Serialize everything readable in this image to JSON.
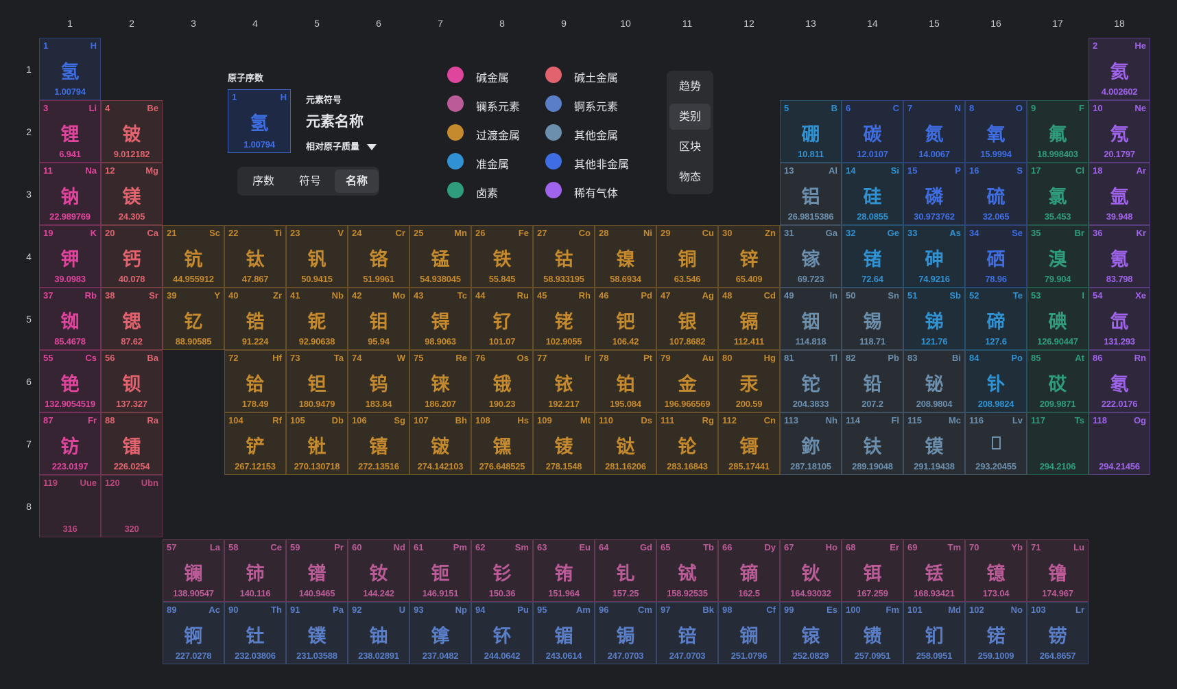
{
  "groups": [
    "1",
    "2",
    "3",
    "4",
    "5",
    "6",
    "7",
    "8",
    "9",
    "10",
    "11",
    "12",
    "13",
    "14",
    "15",
    "16",
    "17",
    "18"
  ],
  "periods": [
    "1",
    "2",
    "3",
    "4",
    "5",
    "6",
    "7",
    "8"
  ],
  "key": {
    "atomic_number_label": "原子序数",
    "symbol_label": "元素符号",
    "name_label": "元素名称",
    "mass_label": "相对原子质量",
    "sample": {
      "number": "1",
      "symbol": "H",
      "name": "氢",
      "mass": "1.00794"
    }
  },
  "display_modes": [
    {
      "label": "序数",
      "active": false
    },
    {
      "label": "符号",
      "active": false
    },
    {
      "label": "名称",
      "active": true
    }
  ],
  "view_modes": [
    {
      "label": "趋势",
      "active": false
    },
    {
      "label": "类别",
      "active": true
    },
    {
      "label": "区块",
      "active": false
    },
    {
      "label": "物态",
      "active": false
    }
  ],
  "categories": {
    "alkali": {
      "label": "碱金属",
      "color": "#e0459d"
    },
    "alkaline": {
      "label": "碱土金属",
      "color": "#e2636e"
    },
    "lanthanide": {
      "label": "镧系元素",
      "color": "#bb5c98"
    },
    "actinide": {
      "label": "锕系元素",
      "color": "#5a7fc8"
    },
    "transition": {
      "label": "过渡金属",
      "color": "#c58a2e"
    },
    "post": {
      "label": "其他金属",
      "color": "#6d8fae"
    },
    "metalloid": {
      "label": "准金属",
      "color": "#3092d2"
    },
    "nonmetal": {
      "label": "其他非金属",
      "color": "#3f6ee4"
    },
    "halogen": {
      "label": "卤素",
      "color": "#2f9c7e"
    },
    "noble": {
      "label": "稀有气体",
      "color": "#a063ec"
    },
    "unknown": {
      "label": "",
      "color": "#b8487e"
    }
  },
  "legend_order": [
    "alkali",
    "alkaline",
    "lanthanide",
    "actinide",
    "transition",
    "post",
    "metalloid",
    "nonmetal",
    "halogen",
    "noble"
  ],
  "elements": [
    {
      "n": "1",
      "s": "H",
      "name": "氢",
      "m": "1.00794",
      "row": 1,
      "col": 1,
      "cat": "nonmetal"
    },
    {
      "n": "2",
      "s": "He",
      "name": "氦",
      "m": "4.002602",
      "row": 1,
      "col": 18,
      "cat": "noble"
    },
    {
      "n": "3",
      "s": "Li",
      "name": "锂",
      "m": "6.941",
      "row": 2,
      "col": 1,
      "cat": "alkali"
    },
    {
      "n": "4",
      "s": "Be",
      "name": "铍",
      "m": "9.012182",
      "row": 2,
      "col": 2,
      "cat": "alkaline"
    },
    {
      "n": "5",
      "s": "B",
      "name": "硼",
      "m": "10.811",
      "row": 2,
      "col": 13,
      "cat": "metalloid"
    },
    {
      "n": "6",
      "s": "C",
      "name": "碳",
      "m": "12.0107",
      "row": 2,
      "col": 14,
      "cat": "nonmetal"
    },
    {
      "n": "7",
      "s": "N",
      "name": "氮",
      "m": "14.0067",
      "row": 2,
      "col": 15,
      "cat": "nonmetal"
    },
    {
      "n": "8",
      "s": "O",
      "name": "氧",
      "m": "15.9994",
      "row": 2,
      "col": 16,
      "cat": "nonmetal"
    },
    {
      "n": "9",
      "s": "F",
      "name": "氟",
      "m": "18.998403",
      "row": 2,
      "col": 17,
      "cat": "halogen"
    },
    {
      "n": "10",
      "s": "Ne",
      "name": "氖",
      "m": "20.1797",
      "row": 2,
      "col": 18,
      "cat": "noble"
    },
    {
      "n": "11",
      "s": "Na",
      "name": "钠",
      "m": "22.989769",
      "row": 3,
      "col": 1,
      "cat": "alkali"
    },
    {
      "n": "12",
      "s": "Mg",
      "name": "镁",
      "m": "24.305",
      "row": 3,
      "col": 2,
      "cat": "alkaline"
    },
    {
      "n": "13",
      "s": "Al",
      "name": "铝",
      "m": "26.9815386",
      "row": 3,
      "col": 13,
      "cat": "post"
    },
    {
      "n": "14",
      "s": "Si",
      "name": "硅",
      "m": "28.0855",
      "row": 3,
      "col": 14,
      "cat": "metalloid"
    },
    {
      "n": "15",
      "s": "P",
      "name": "磷",
      "m": "30.973762",
      "row": 3,
      "col": 15,
      "cat": "nonmetal"
    },
    {
      "n": "16",
      "s": "S",
      "name": "硫",
      "m": "32.065",
      "row": 3,
      "col": 16,
      "cat": "nonmetal"
    },
    {
      "n": "17",
      "s": "Cl",
      "name": "氯",
      "m": "35.453",
      "row": 3,
      "col": 17,
      "cat": "halogen"
    },
    {
      "n": "18",
      "s": "Ar",
      "name": "氩",
      "m": "39.948",
      "row": 3,
      "col": 18,
      "cat": "noble"
    },
    {
      "n": "19",
      "s": "K",
      "name": "钾",
      "m": "39.0983",
      "row": 4,
      "col": 1,
      "cat": "alkali"
    },
    {
      "n": "20",
      "s": "Ca",
      "name": "钙",
      "m": "40.078",
      "row": 4,
      "col": 2,
      "cat": "alkaline"
    },
    {
      "n": "21",
      "s": "Sc",
      "name": "钪",
      "m": "44.955912",
      "row": 4,
      "col": 3,
      "cat": "transition"
    },
    {
      "n": "22",
      "s": "Ti",
      "name": "钛",
      "m": "47.867",
      "row": 4,
      "col": 4,
      "cat": "transition"
    },
    {
      "n": "23",
      "s": "V",
      "name": "钒",
      "m": "50.9415",
      "row": 4,
      "col": 5,
      "cat": "transition"
    },
    {
      "n": "24",
      "s": "Cr",
      "name": "铬",
      "m": "51.9961",
      "row": 4,
      "col": 6,
      "cat": "transition"
    },
    {
      "n": "25",
      "s": "Mn",
      "name": "锰",
      "m": "54.938045",
      "row": 4,
      "col": 7,
      "cat": "transition"
    },
    {
      "n": "26",
      "s": "Fe",
      "name": "铁",
      "m": "55.845",
      "row": 4,
      "col": 8,
      "cat": "transition"
    },
    {
      "n": "27",
      "s": "Co",
      "name": "钴",
      "m": "58.933195",
      "row": 4,
      "col": 9,
      "cat": "transition"
    },
    {
      "n": "28",
      "s": "Ni",
      "name": "镍",
      "m": "58.6934",
      "row": 4,
      "col": 10,
      "cat": "transition"
    },
    {
      "n": "29",
      "s": "Cu",
      "name": "铜",
      "m": "63.546",
      "row": 4,
      "col": 11,
      "cat": "transition"
    },
    {
      "n": "30",
      "s": "Zn",
      "name": "锌",
      "m": "65.409",
      "row": 4,
      "col": 12,
      "cat": "transition"
    },
    {
      "n": "31",
      "s": "Ga",
      "name": "镓",
      "m": "69.723",
      "row": 4,
      "col": 13,
      "cat": "post"
    },
    {
      "n": "32",
      "s": "Ge",
      "name": "锗",
      "m": "72.64",
      "row": 4,
      "col": 14,
      "cat": "metalloid"
    },
    {
      "n": "33",
      "s": "As",
      "name": "砷",
      "m": "74.9216",
      "row": 4,
      "col": 15,
      "cat": "metalloid"
    },
    {
      "n": "34",
      "s": "Se",
      "name": "硒",
      "m": "78.96",
      "row": 4,
      "col": 16,
      "cat": "nonmetal"
    },
    {
      "n": "35",
      "s": "Br",
      "name": "溴",
      "m": "79.904",
      "row": 4,
      "col": 17,
      "cat": "halogen"
    },
    {
      "n": "36",
      "s": "Kr",
      "name": "氪",
      "m": "83.798",
      "row": 4,
      "col": 18,
      "cat": "noble"
    },
    {
      "n": "37",
      "s": "Rb",
      "name": "铷",
      "m": "85.4678",
      "row": 5,
      "col": 1,
      "cat": "alkali"
    },
    {
      "n": "38",
      "s": "Sr",
      "name": "锶",
      "m": "87.62",
      "row": 5,
      "col": 2,
      "cat": "alkaline"
    },
    {
      "n": "39",
      "s": "Y",
      "name": "钇",
      "m": "88.90585",
      "row": 5,
      "col": 3,
      "cat": "transition"
    },
    {
      "n": "40",
      "s": "Zr",
      "name": "锆",
      "m": "91.224",
      "row": 5,
      "col": 4,
      "cat": "transition"
    },
    {
      "n": "41",
      "s": "Nb",
      "name": "铌",
      "m": "92.90638",
      "row": 5,
      "col": 5,
      "cat": "transition"
    },
    {
      "n": "42",
      "s": "Mo",
      "name": "钼",
      "m": "95.94",
      "row": 5,
      "col": 6,
      "cat": "transition"
    },
    {
      "n": "43",
      "s": "Tc",
      "name": "锝",
      "m": "98.9063",
      "row": 5,
      "col": 7,
      "cat": "transition"
    },
    {
      "n": "44",
      "s": "Ru",
      "name": "钌",
      "m": "101.07",
      "row": 5,
      "col": 8,
      "cat": "transition"
    },
    {
      "n": "45",
      "s": "Rh",
      "name": "铑",
      "m": "102.9055",
      "row": 5,
      "col": 9,
      "cat": "transition"
    },
    {
      "n": "46",
      "s": "Pd",
      "name": "钯",
      "m": "106.42",
      "row": 5,
      "col": 10,
      "cat": "transition"
    },
    {
      "n": "47",
      "s": "Ag",
      "name": "银",
      "m": "107.8682",
      "row": 5,
      "col": 11,
      "cat": "transition"
    },
    {
      "n": "48",
      "s": "Cd",
      "name": "镉",
      "m": "112.411",
      "row": 5,
      "col": 12,
      "cat": "transition"
    },
    {
      "n": "49",
      "s": "In",
      "name": "铟",
      "m": "114.818",
      "row": 5,
      "col": 13,
      "cat": "post"
    },
    {
      "n": "50",
      "s": "Sn",
      "name": "锡",
      "m": "118.71",
      "row": 5,
      "col": 14,
      "cat": "post"
    },
    {
      "n": "51",
      "s": "Sb",
      "name": "锑",
      "m": "121.76",
      "row": 5,
      "col": 15,
      "cat": "metalloid"
    },
    {
      "n": "52",
      "s": "Te",
      "name": "碲",
      "m": "127.6",
      "row": 5,
      "col": 16,
      "cat": "metalloid"
    },
    {
      "n": "53",
      "s": "I",
      "name": "碘",
      "m": "126.90447",
      "row": 5,
      "col": 17,
      "cat": "halogen"
    },
    {
      "n": "54",
      "s": "Xe",
      "name": "氙",
      "m": "131.293",
      "row": 5,
      "col": 18,
      "cat": "noble"
    },
    {
      "n": "55",
      "s": "Cs",
      "name": "铯",
      "m": "132.9054519",
      "row": 6,
      "col": 1,
      "cat": "alkali"
    },
    {
      "n": "56",
      "s": "Ba",
      "name": "钡",
      "m": "137.327",
      "row": 6,
      "col": 2,
      "cat": "alkaline"
    },
    {
      "n": "72",
      "s": "Hf",
      "name": "铪",
      "m": "178.49",
      "row": 6,
      "col": 4,
      "cat": "transition"
    },
    {
      "n": "73",
      "s": "Ta",
      "name": "钽",
      "m": "180.9479",
      "row": 6,
      "col": 5,
      "cat": "transition"
    },
    {
      "n": "74",
      "s": "W",
      "name": "钨",
      "m": "183.84",
      "row": 6,
      "col": 6,
      "cat": "transition"
    },
    {
      "n": "75",
      "s": "Re",
      "name": "铼",
      "m": "186.207",
      "row": 6,
      "col": 7,
      "cat": "transition"
    },
    {
      "n": "76",
      "s": "Os",
      "name": "锇",
      "m": "190.23",
      "row": 6,
      "col": 8,
      "cat": "transition"
    },
    {
      "n": "77",
      "s": "Ir",
      "name": "铱",
      "m": "192.217",
      "row": 6,
      "col": 9,
      "cat": "transition"
    },
    {
      "n": "78",
      "s": "Pt",
      "name": "铂",
      "m": "195.084",
      "row": 6,
      "col": 10,
      "cat": "transition"
    },
    {
      "n": "79",
      "s": "Au",
      "name": "金",
      "m": "196.966569",
      "row": 6,
      "col": 11,
      "cat": "transition"
    },
    {
      "n": "80",
      "s": "Hg",
      "name": "汞",
      "m": "200.59",
      "row": 6,
      "col": 12,
      "cat": "transition"
    },
    {
      "n": "81",
      "s": "Tl",
      "name": "铊",
      "m": "204.3833",
      "row": 6,
      "col": 13,
      "cat": "post"
    },
    {
      "n": "82",
      "s": "Pb",
      "name": "铅",
      "m": "207.2",
      "row": 6,
      "col": 14,
      "cat": "post"
    },
    {
      "n": "83",
      "s": "Bi",
      "name": "铋",
      "m": "208.9804",
      "row": 6,
      "col": 15,
      "cat": "post"
    },
    {
      "n": "84",
      "s": "Po",
      "name": "钋",
      "m": "208.9824",
      "row": 6,
      "col": 16,
      "cat": "metalloid"
    },
    {
      "n": "85",
      "s": "At",
      "name": "砹",
      "m": "209.9871",
      "row": 6,
      "col": 17,
      "cat": "halogen"
    },
    {
      "n": "86",
      "s": "Rn",
      "name": "氡",
      "m": "222.0176",
      "row": 6,
      "col": 18,
      "cat": "noble"
    },
    {
      "n": "87",
      "s": "Fr",
      "name": "钫",
      "m": "223.0197",
      "row": 7,
      "col": 1,
      "cat": "alkali"
    },
    {
      "n": "88",
      "s": "Ra",
      "name": "镭",
      "m": "226.0254",
      "row": 7,
      "col": 2,
      "cat": "alkaline"
    },
    {
      "n": "104",
      "s": "Rf",
      "name": "铲",
      "m": "267.12153",
      "row": 7,
      "col": 4,
      "cat": "transition"
    },
    {
      "n": "105",
      "s": "Db",
      "name": "𬭊",
      "m": "270.130718",
      "row": 7,
      "col": 5,
      "cat": "transition"
    },
    {
      "n": "106",
      "s": "Sg",
      "name": "𬭳",
      "m": "272.13516",
      "row": 7,
      "col": 6,
      "cat": "transition"
    },
    {
      "n": "107",
      "s": "Bh",
      "name": "𬭛",
      "m": "274.142103",
      "row": 7,
      "col": 7,
      "cat": "transition"
    },
    {
      "n": "108",
      "s": "Hs",
      "name": "𬭶",
      "m": "276.648525",
      "row": 7,
      "col": 8,
      "cat": "transition"
    },
    {
      "n": "109",
      "s": "Mt",
      "name": "鿏",
      "m": "278.1548",
      "row": 7,
      "col": 9,
      "cat": "transition"
    },
    {
      "n": "110",
      "s": "Ds",
      "name": "𫟼",
      "m": "281.16206",
      "row": 7,
      "col": 10,
      "cat": "transition"
    },
    {
      "n": "111",
      "s": "Rg",
      "name": "𬬭",
      "m": "283.16843",
      "row": 7,
      "col": 11,
      "cat": "transition"
    },
    {
      "n": "112",
      "s": "Cn",
      "name": "鿔",
      "m": "285.17441",
      "row": 7,
      "col": 12,
      "cat": "transition"
    },
    {
      "n": "113",
      "s": "Nh",
      "name": "鉨",
      "m": "287.18105",
      "row": 7,
      "col": 13,
      "cat": "post"
    },
    {
      "n": "114",
      "s": "Fl",
      "name": "𫓧",
      "m": "289.19048",
      "row": 7,
      "col": 14,
      "cat": "post"
    },
    {
      "n": "115",
      "s": "Mc",
      "name": "镆",
      "m": "291.19438",
      "row": 7,
      "col": 15,
      "cat": "post"
    },
    {
      "n": "116",
      "s": "Lv",
      "name": "𫟷",
      "m": "293.20455",
      "row": 7,
      "col": 16,
      "cat": "post"
    },
    {
      "n": "117",
      "s": "Ts",
      "name": "",
      "m": "294.2106",
      "row": 7,
      "col": 17,
      "cat": "halogen"
    },
    {
      "n": "118",
      "s": "Og",
      "name": "",
      "m": "294.21456",
      "row": 7,
      "col": 18,
      "cat": "noble"
    },
    {
      "n": "119",
      "s": "Uue",
      "name": "",
      "m": "316",
      "row": 8,
      "col": 1,
      "cat": "unknown"
    },
    {
      "n": "120",
      "s": "Ubn",
      "name": "",
      "m": "320",
      "row": 8,
      "col": 2,
      "cat": "unknown"
    },
    {
      "n": "57",
      "s": "La",
      "name": "镧",
      "m": "138.90547",
      "row": 9,
      "col": 3,
      "cat": "lanthanide"
    },
    {
      "n": "58",
      "s": "Ce",
      "name": "铈",
      "m": "140.116",
      "row": 9,
      "col": 4,
      "cat": "lanthanide"
    },
    {
      "n": "59",
      "s": "Pr",
      "name": "镨",
      "m": "140.9465",
      "row": 9,
      "col": 5,
      "cat": "lanthanide"
    },
    {
      "n": "60",
      "s": "Nd",
      "name": "钕",
      "m": "144.242",
      "row": 9,
      "col": 6,
      "cat": "lanthanide"
    },
    {
      "n": "61",
      "s": "Pm",
      "name": "钷",
      "m": "146.9151",
      "row": 9,
      "col": 7,
      "cat": "lanthanide"
    },
    {
      "n": "62",
      "s": "Sm",
      "name": "钐",
      "m": "150.36",
      "row": 9,
      "col": 8,
      "cat": "lanthanide"
    },
    {
      "n": "63",
      "s": "Eu",
      "name": "铕",
      "m": "151.964",
      "row": 9,
      "col": 9,
      "cat": "lanthanide"
    },
    {
      "n": "64",
      "s": "Gd",
      "name": "钆",
      "m": "157.25",
      "row": 9,
      "col": 10,
      "cat": "lanthanide"
    },
    {
      "n": "65",
      "s": "Tb",
      "name": "铽",
      "m": "158.92535",
      "row": 9,
      "col": 11,
      "cat": "lanthanide"
    },
    {
      "n": "66",
      "s": "Dy",
      "name": "镝",
      "m": "162.5",
      "row": 9,
      "col": 12,
      "cat": "lanthanide"
    },
    {
      "n": "67",
      "s": "Ho",
      "name": "钬",
      "m": "164.93032",
      "row": 9,
      "col": 13,
      "cat": "lanthanide"
    },
    {
      "n": "68",
      "s": "Er",
      "name": "铒",
      "m": "167.259",
      "row": 9,
      "col": 14,
      "cat": "lanthanide"
    },
    {
      "n": "69",
      "s": "Tm",
      "name": "铥",
      "m": "168.93421",
      "row": 9,
      "col": 15,
      "cat": "lanthanide"
    },
    {
      "n": "70",
      "s": "Yb",
      "name": "镱",
      "m": "173.04",
      "row": 9,
      "col": 16,
      "cat": "lanthanide"
    },
    {
      "n": "71",
      "s": "Lu",
      "name": "镥",
      "m": "174.967",
      "row": 9,
      "col": 17,
      "cat": "lanthanide"
    },
    {
      "n": "89",
      "s": "Ac",
      "name": "锕",
      "m": "227.0278",
      "row": 10,
      "col": 3,
      "cat": "actinide"
    },
    {
      "n": "90",
      "s": "Th",
      "name": "钍",
      "m": "232.03806",
      "row": 10,
      "col": 4,
      "cat": "actinide"
    },
    {
      "n": "91",
      "s": "Pa",
      "name": "镤",
      "m": "231.03588",
      "row": 10,
      "col": 5,
      "cat": "actinide"
    },
    {
      "n": "92",
      "s": "U",
      "name": "铀",
      "m": "238.02891",
      "row": 10,
      "col": 6,
      "cat": "actinide"
    },
    {
      "n": "93",
      "s": "Np",
      "name": "镎",
      "m": "237.0482",
      "row": 10,
      "col": 7,
      "cat": "actinide"
    },
    {
      "n": "94",
      "s": "Pu",
      "name": "钚",
      "m": "244.0642",
      "row": 10,
      "col": 8,
      "cat": "actinide"
    },
    {
      "n": "95",
      "s": "Am",
      "name": "镅",
      "m": "243.0614",
      "row": 10,
      "col": 9,
      "cat": "actinide"
    },
    {
      "n": "96",
      "s": "Cm",
      "name": "锔",
      "m": "247.0703",
      "row": 10,
      "col": 10,
      "cat": "actinide"
    },
    {
      "n": "97",
      "s": "Bk",
      "name": "锫",
      "m": "247.0703",
      "row": 10,
      "col": 11,
      "cat": "actinide"
    },
    {
      "n": "98",
      "s": "Cf",
      "name": "锎",
      "m": "251.0796",
      "row": 10,
      "col": 12,
      "cat": "actinide"
    },
    {
      "n": "99",
      "s": "Es",
      "name": "锿",
      "m": "252.0829",
      "row": 10,
      "col": 13,
      "cat": "actinide"
    },
    {
      "n": "100",
      "s": "Fm",
      "name": "镄",
      "m": "257.0951",
      "row": 10,
      "col": 14,
      "cat": "actinide"
    },
    {
      "n": "101",
      "s": "Md",
      "name": "钔",
      "m": "258.0951",
      "row": 10,
      "col": 15,
      "cat": "actinide"
    },
    {
      "n": "102",
      "s": "No",
      "name": "锘",
      "m": "259.1009",
      "row": 10,
      "col": 16,
      "cat": "actinide"
    },
    {
      "n": "103",
      "s": "Lr",
      "name": "铹",
      "m": "264.8657",
      "row": 10,
      "col": 17,
      "cat": "actinide"
    }
  ]
}
